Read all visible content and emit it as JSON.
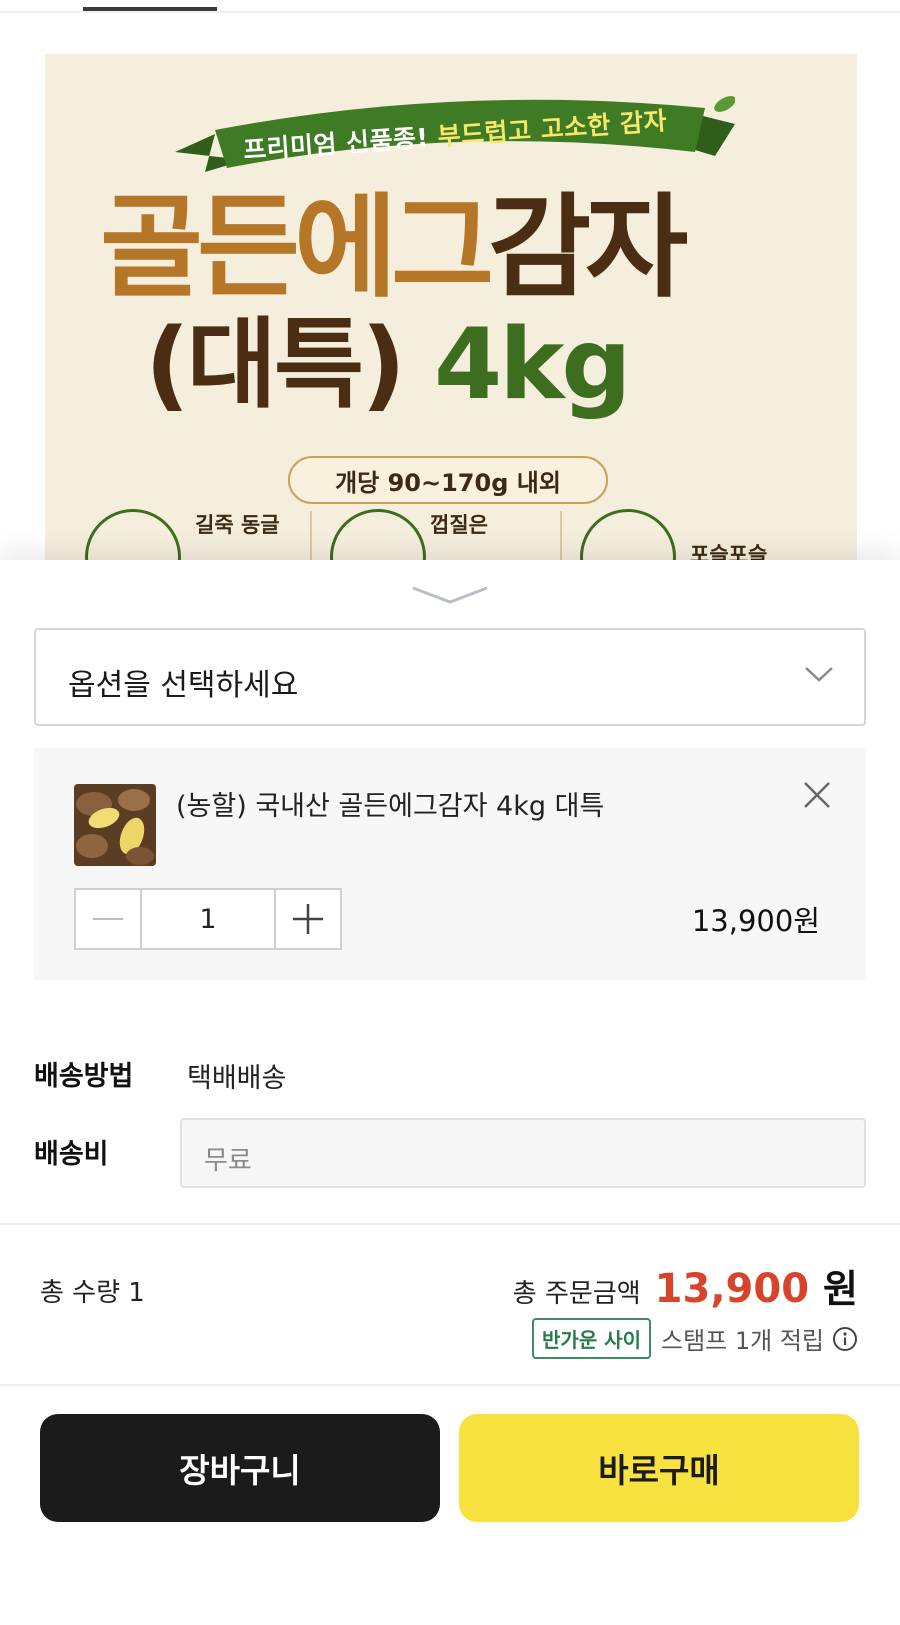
{
  "banner": {
    "ribbon_prefix": "프리미엄 신품종!",
    "ribbon_highlight": "부드럽고 고소한 감자",
    "headline_gold": "골든에그",
    "headline_dark": "감자",
    "headline_sub_dark": "(대특)",
    "headline_sub_green": "4kg",
    "size_note": "개당 90~170g 내외",
    "features": [
      "길죽 동글",
      "껍질은",
      "포슬포슬"
    ]
  },
  "sheet": {
    "option_placeholder": "옵션을 선택하세요",
    "selected_item": {
      "name": "(농할) 국내산 골든에그감자 4kg 대특",
      "quantity": "1",
      "price": "13,900원"
    },
    "shipping": {
      "method_label": "배송방법",
      "method_value": "택배배송",
      "fee_label": "배송비",
      "fee_value": "무료"
    },
    "summary": {
      "total_qty": "총 수량 1",
      "total_amount_label": "총 주문금액",
      "total_amount_value": "13,900",
      "total_amount_unit": "원",
      "stamp_badge": "반가운 사이",
      "stamp_text": "스탬프 1개 적립"
    },
    "buttons": {
      "cart": "장바구니",
      "buy": "바로구매"
    }
  },
  "colors": {
    "accent_price": "#d8432b",
    "buy_button": "#f8e23f",
    "cart_button": "#1b1b1b",
    "stamp_badge": "#2a7a50"
  },
  "icons": [
    "chevron-down-icon",
    "sheet-collapse-icon",
    "close-icon",
    "minus-icon",
    "plus-icon",
    "info-icon"
  ]
}
